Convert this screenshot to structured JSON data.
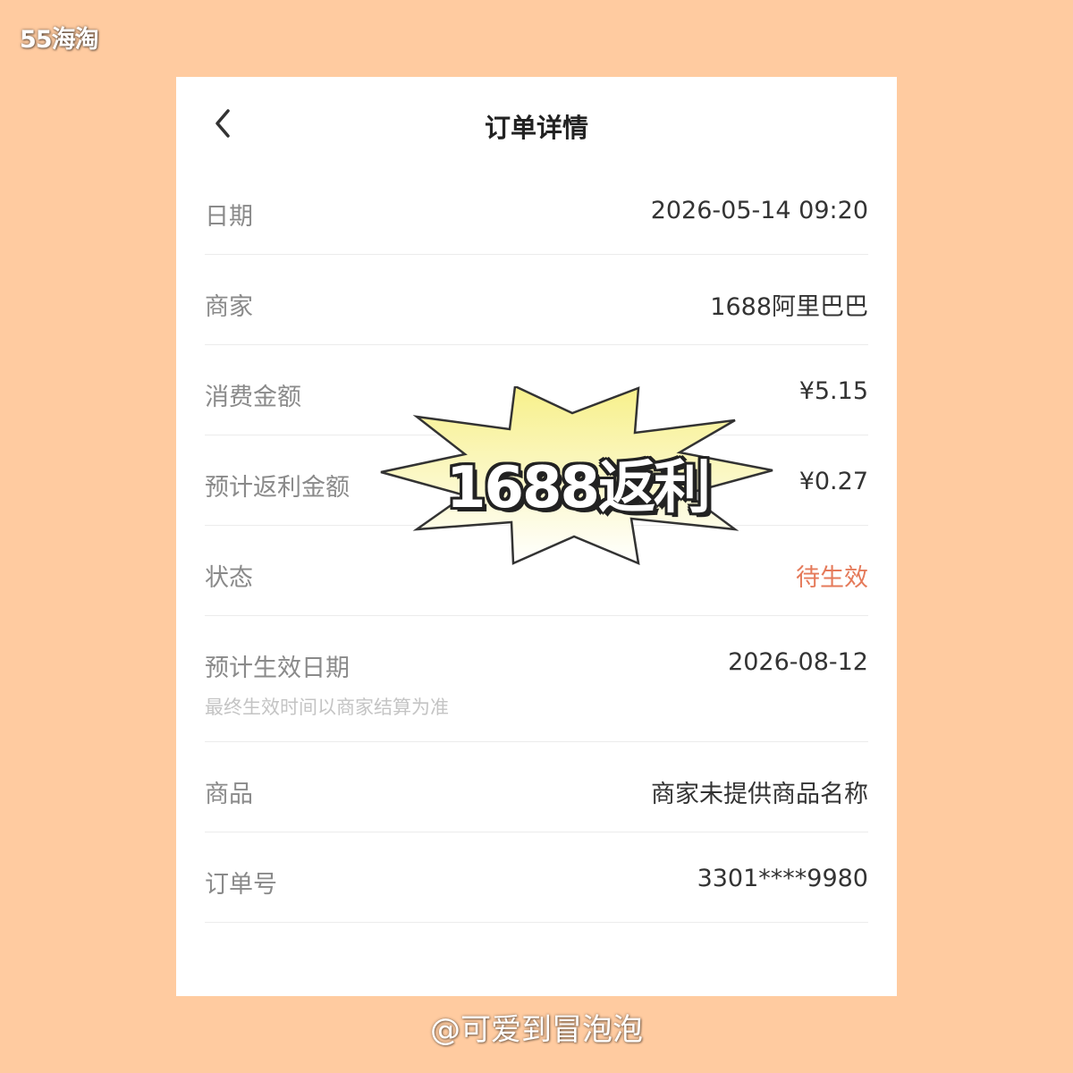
{
  "watermark": {
    "top": "55海淘",
    "bottom": "@可爱到冒泡泡"
  },
  "header": {
    "title": "订单详情",
    "back_icon": "chevron-left-icon"
  },
  "rows": [
    {
      "label": "日期",
      "value": "2026-05-14 09:20"
    },
    {
      "label": "商家",
      "value": "1688阿里巴巴"
    },
    {
      "label": "消费金额",
      "value": "¥5.15"
    },
    {
      "label": "预计返利金额",
      "value": "¥0.27"
    },
    {
      "label": "状态",
      "value": "待生效"
    },
    {
      "label": "预计生效日期",
      "value": "2026-08-12",
      "hint": "最终生效时间以商家结算为准"
    },
    {
      "label": "商品",
      "value": "商家未提供商品名称"
    },
    {
      "label": "订单号",
      "value": "3301****9980"
    }
  ],
  "overlay": {
    "text": "1688返利"
  },
  "colors": {
    "background": "#FFCBA0",
    "status": "#E57A5A",
    "burst_fill_top": "#F7F08A",
    "burst_fill_bottom": "#FFFFFF"
  }
}
